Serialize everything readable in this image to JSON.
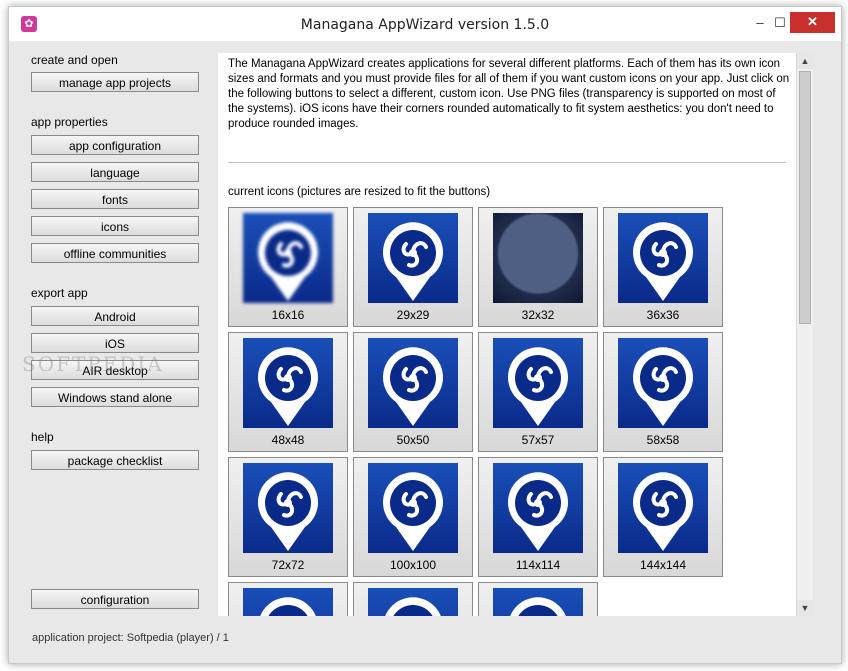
{
  "window": {
    "title": "Managana AppWizard version 1.5.0",
    "controls": {
      "minimize": "–",
      "maximize": "☐",
      "close": "✕"
    },
    "app_icon": "managana-icon"
  },
  "sidebar": {
    "sections": [
      {
        "label": "create and open",
        "buttons": [
          "manage app projects"
        ]
      },
      {
        "label": "app properties",
        "buttons": [
          "app configuration",
          "language",
          "fonts",
          "icons",
          "offline communities"
        ]
      },
      {
        "label": "export app",
        "buttons": [
          "Android",
          "iOS",
          "AIR desktop",
          "Windows stand alone"
        ]
      },
      {
        "label": "help",
        "buttons": [
          "package checklist"
        ]
      }
    ],
    "bottom_button": "configuration"
  },
  "content": {
    "description": "The Managana AppWizard creates applications for several different platforms. Each of them has its own icon sizes and formats and you must provide files for all of them if you want custom icons on your app. Just click on the following buttons to select a different, custom icon. Use PNG files (transparency is supported on most of the systems). iOS icons have their corners rounded automatically to fit system aesthetics: you don't need to produce rounded images.",
    "icons_label": "current icons (pictures are resized to fit the buttons)",
    "icons": [
      {
        "label": "16x16"
      },
      {
        "label": "29x29"
      },
      {
        "label": "32x32"
      },
      {
        "label": "36x36"
      },
      {
        "label": "48x48"
      },
      {
        "label": "50x50"
      },
      {
        "label": "57x57"
      },
      {
        "label": "58x58"
      },
      {
        "label": "72x72"
      },
      {
        "label": "100x100"
      },
      {
        "label": "114x114"
      },
      {
        "label": "144x144"
      },
      {
        "label": ""
      },
      {
        "label": ""
      },
      {
        "label": ""
      }
    ]
  },
  "scrollbar": {
    "up": "▲",
    "down": "▼"
  },
  "status": {
    "text": "application project: Softpedia (player) / 1"
  },
  "watermark": "SOFTPEDIA",
  "colors": {
    "icon_blue": "#0a2a8a",
    "close_red": "#c7302c",
    "app_icon_pink": "#d0389a"
  }
}
